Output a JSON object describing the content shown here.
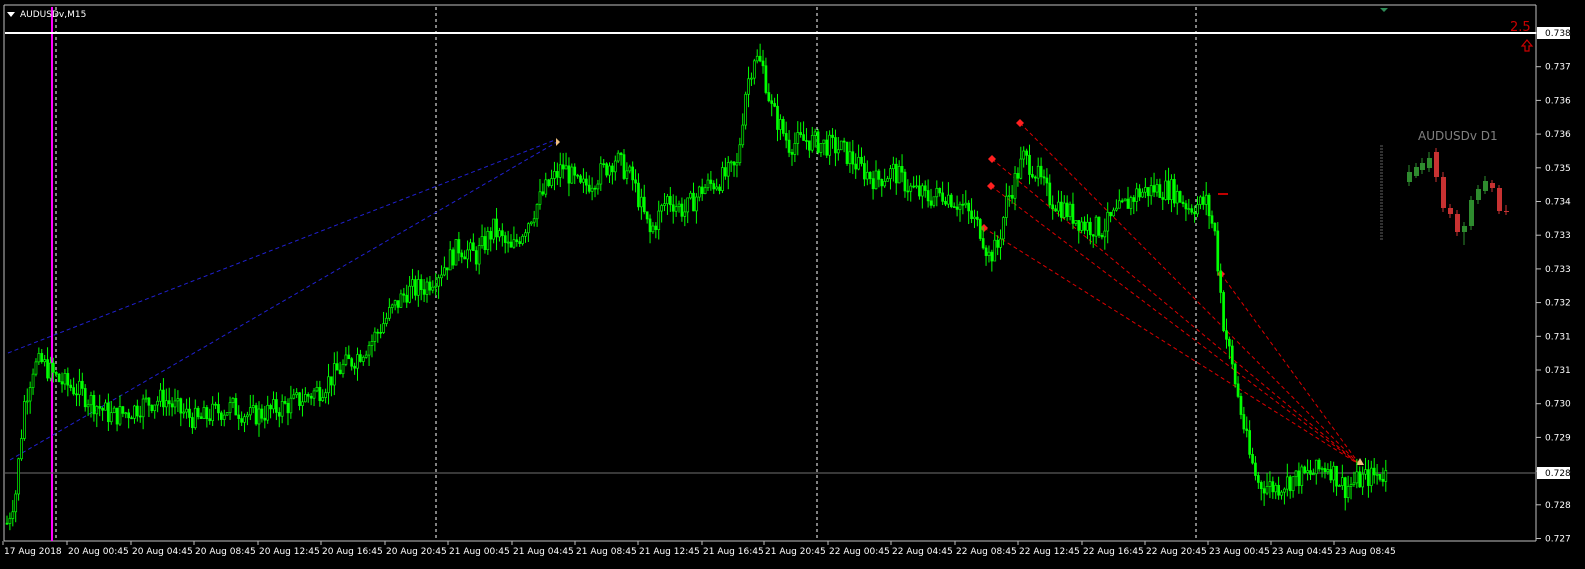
{
  "window": {
    "symbol_title": "AUDUSDv,M15"
  },
  "price_scale": {
    "labels": [
      "0.738",
      "0.737",
      "0.736",
      "0.736",
      "0.735",
      "0.734",
      "0.733",
      "0.733",
      "0.732",
      "0.731",
      "0.731",
      "0.730",
      "0.729",
      "0.728",
      "0.728",
      "0.727"
    ],
    "current_price_label": "0.728",
    "top_line_label": "0.738"
  },
  "time_scale": {
    "labels": [
      "17 Aug 2018",
      "20 Aug 00:45",
      "20 Aug 04:45",
      "20 Aug 08:45",
      "20 Aug 12:45",
      "20 Aug 16:45",
      "20 Aug 20:45",
      "21 Aug 00:45",
      "21 Aug 04:45",
      "21 Aug 08:45",
      "21 Aug 12:45",
      "21 Aug 16:45",
      "21 Aug 20:45",
      "22 Aug 00:45",
      "22 Aug 04:45",
      "22 Aug 08:45",
      "22 Aug 12:45",
      "22 Aug 16:45",
      "22 Aug 20:45",
      "23 Aug 00:45",
      "23 Aug 04:45",
      "23 Aug 08:45"
    ]
  },
  "indicator": {
    "value_text": "2.5",
    "arrow_icon": "up-arrow-icon",
    "color": "#cc0000"
  },
  "mini_chart": {
    "title": "AUDUSDv D1"
  },
  "colors": {
    "background": "#000000",
    "candle": "#00ff00",
    "grid_v": "#ffffff",
    "period_separator": "#ff00ff",
    "trend_blue": "#2020d0",
    "trend_red": "#dd0000",
    "mini_bull": "#2e8b2e",
    "mini_bear": "#c83232"
  },
  "chart_data": {
    "type": "candlestick",
    "symbol": "AUDUSDv",
    "timeframe": "M15",
    "ylim": [
      0.7271,
      0.7385
    ],
    "price_path": [
      [
        0,
        0.7275
      ],
      [
        1,
        0.7282
      ],
      [
        2,
        0.7302
      ],
      [
        3,
        0.731
      ],
      [
        4,
        0.7311
      ],
      [
        5,
        0.7309
      ],
      [
        6,
        0.7307
      ],
      [
        8,
        0.7305
      ],
      [
        10,
        0.7302
      ],
      [
        12,
        0.7299
      ],
      [
        14,
        0.73
      ],
      [
        16,
        0.7302
      ],
      [
        18,
        0.7303
      ],
      [
        20,
        0.73
      ],
      [
        22,
        0.7298
      ],
      [
        24,
        0.73
      ],
      [
        26,
        0.7301
      ],
      [
        28,
        0.7299
      ],
      [
        30,
        0.73
      ],
      [
        33,
        0.7302
      ],
      [
        36,
        0.7305
      ],
      [
        38,
        0.7309
      ],
      [
        40,
        0.7312
      ],
      [
        42,
        0.7316
      ],
      [
        44,
        0.7322
      ],
      [
        46,
        0.7327
      ],
      [
        48,
        0.7328
      ],
      [
        50,
        0.7332
      ],
      [
        52,
        0.7337
      ],
      [
        54,
        0.7335
      ],
      [
        56,
        0.7341
      ],
      [
        58,
        0.7336
      ],
      [
        60,
        0.7343
      ],
      [
        62,
        0.735
      ],
      [
        64,
        0.7355
      ],
      [
        66,
        0.735
      ],
      [
        68,
        0.7353
      ],
      [
        70,
        0.7357
      ],
      [
        72,
        0.7352
      ],
      [
        74,
        0.734
      ],
      [
        76,
        0.7348
      ],
      [
        78,
        0.7345
      ],
      [
        80,
        0.735
      ],
      [
        82,
        0.7352
      ],
      [
        84,
        0.7355
      ],
      [
        85,
        0.7372
      ],
      [
        86,
        0.738
      ],
      [
        87,
        0.7377
      ],
      [
        88,
        0.7368
      ],
      [
        90,
        0.736
      ],
      [
        92,
        0.7361
      ],
      [
        94,
        0.736
      ],
      [
        96,
        0.7359
      ],
      [
        98,
        0.7355
      ],
      [
        100,
        0.7352
      ],
      [
        102,
        0.7354
      ],
      [
        104,
        0.735
      ],
      [
        106,
        0.7348
      ],
      [
        108,
        0.7349
      ],
      [
        110,
        0.7346
      ],
      [
        112,
        0.7341
      ],
      [
        113,
        0.7335
      ],
      [
        114,
        0.7337
      ],
      [
        115,
        0.7347
      ],
      [
        116,
        0.7352
      ],
      [
        117,
        0.7357
      ],
      [
        118,
        0.7355
      ],
      [
        120,
        0.7348
      ],
      [
        122,
        0.7345
      ],
      [
        124,
        0.7342
      ],
      [
        126,
        0.7341
      ],
      [
        128,
        0.7345
      ],
      [
        130,
        0.7349
      ],
      [
        132,
        0.735
      ],
      [
        134,
        0.735
      ],
      [
        136,
        0.7346
      ],
      [
        138,
        0.7347
      ],
      [
        139,
        0.734
      ],
      [
        140,
        0.732
      ],
      [
        141,
        0.731
      ],
      [
        142,
        0.73
      ],
      [
        143,
        0.729
      ],
      [
        144,
        0.7284
      ],
      [
        146,
        0.7283
      ],
      [
        148,
        0.7285
      ],
      [
        150,
        0.7286
      ],
      [
        152,
        0.7288
      ],
      [
        154,
        0.7283
      ],
      [
        156,
        0.7285
      ],
      [
        158,
        0.7286
      ]
    ],
    "current_price": 0.7284,
    "top_horizontal_line": 0.7385
  }
}
